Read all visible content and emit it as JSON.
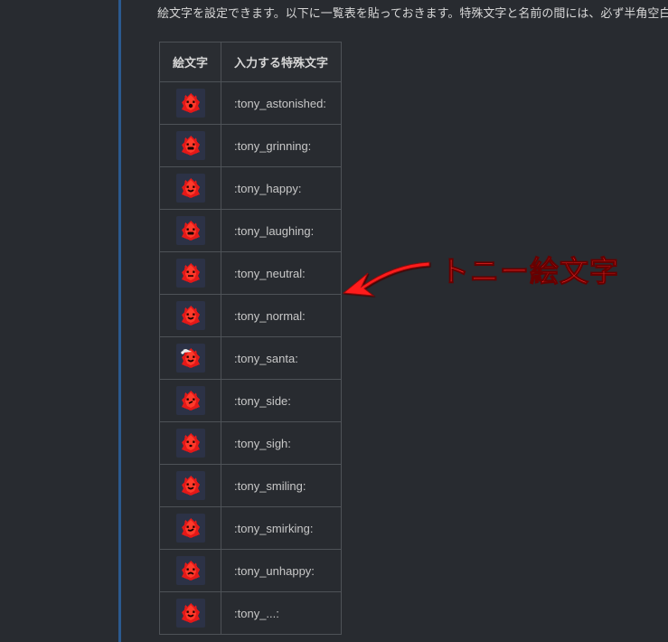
{
  "intro": "絵文字を設定できます。以下に一覧表を貼っておきます。特殊文字と名前の間には、必ず半角空白が",
  "headers": {
    "emoji": "絵文字",
    "code": "入力する特殊文字"
  },
  "rows": [
    {
      "code": ":tony_astonished:",
      "mouth": "O",
      "hasHat": false
    },
    {
      "code": ":tony_grinning:",
      "mouth": "wide",
      "hasHat": false
    },
    {
      "code": ":tony_happy:",
      "mouth": "smile",
      "hasHat": false
    },
    {
      "code": ":tony_laughing:",
      "mouth": "wide",
      "hasHat": false
    },
    {
      "code": ":tony_neutral:",
      "mouth": "flat",
      "hasHat": false
    },
    {
      "code": ":tony_normal:",
      "mouth": "smile",
      "hasHat": false
    },
    {
      "code": ":tony_santa:",
      "mouth": "smile",
      "hasHat": true
    },
    {
      "code": ":tony_side:",
      "mouth": "side",
      "hasHat": false
    },
    {
      "code": ":tony_sigh:",
      "mouth": "small",
      "hasHat": false
    },
    {
      "code": ":tony_smiling:",
      "mouth": "smile",
      "hasHat": false
    },
    {
      "code": ":tony_smirking:",
      "mouth": "smirk",
      "hasHat": false
    },
    {
      "code": ":tony_unhappy:",
      "mouth": "frown",
      "hasHat": false
    },
    {
      "code": ":tony_...:",
      "mouth": "smile",
      "hasHat": false
    }
  ],
  "annotation": {
    "text": "トニー絵文字"
  }
}
